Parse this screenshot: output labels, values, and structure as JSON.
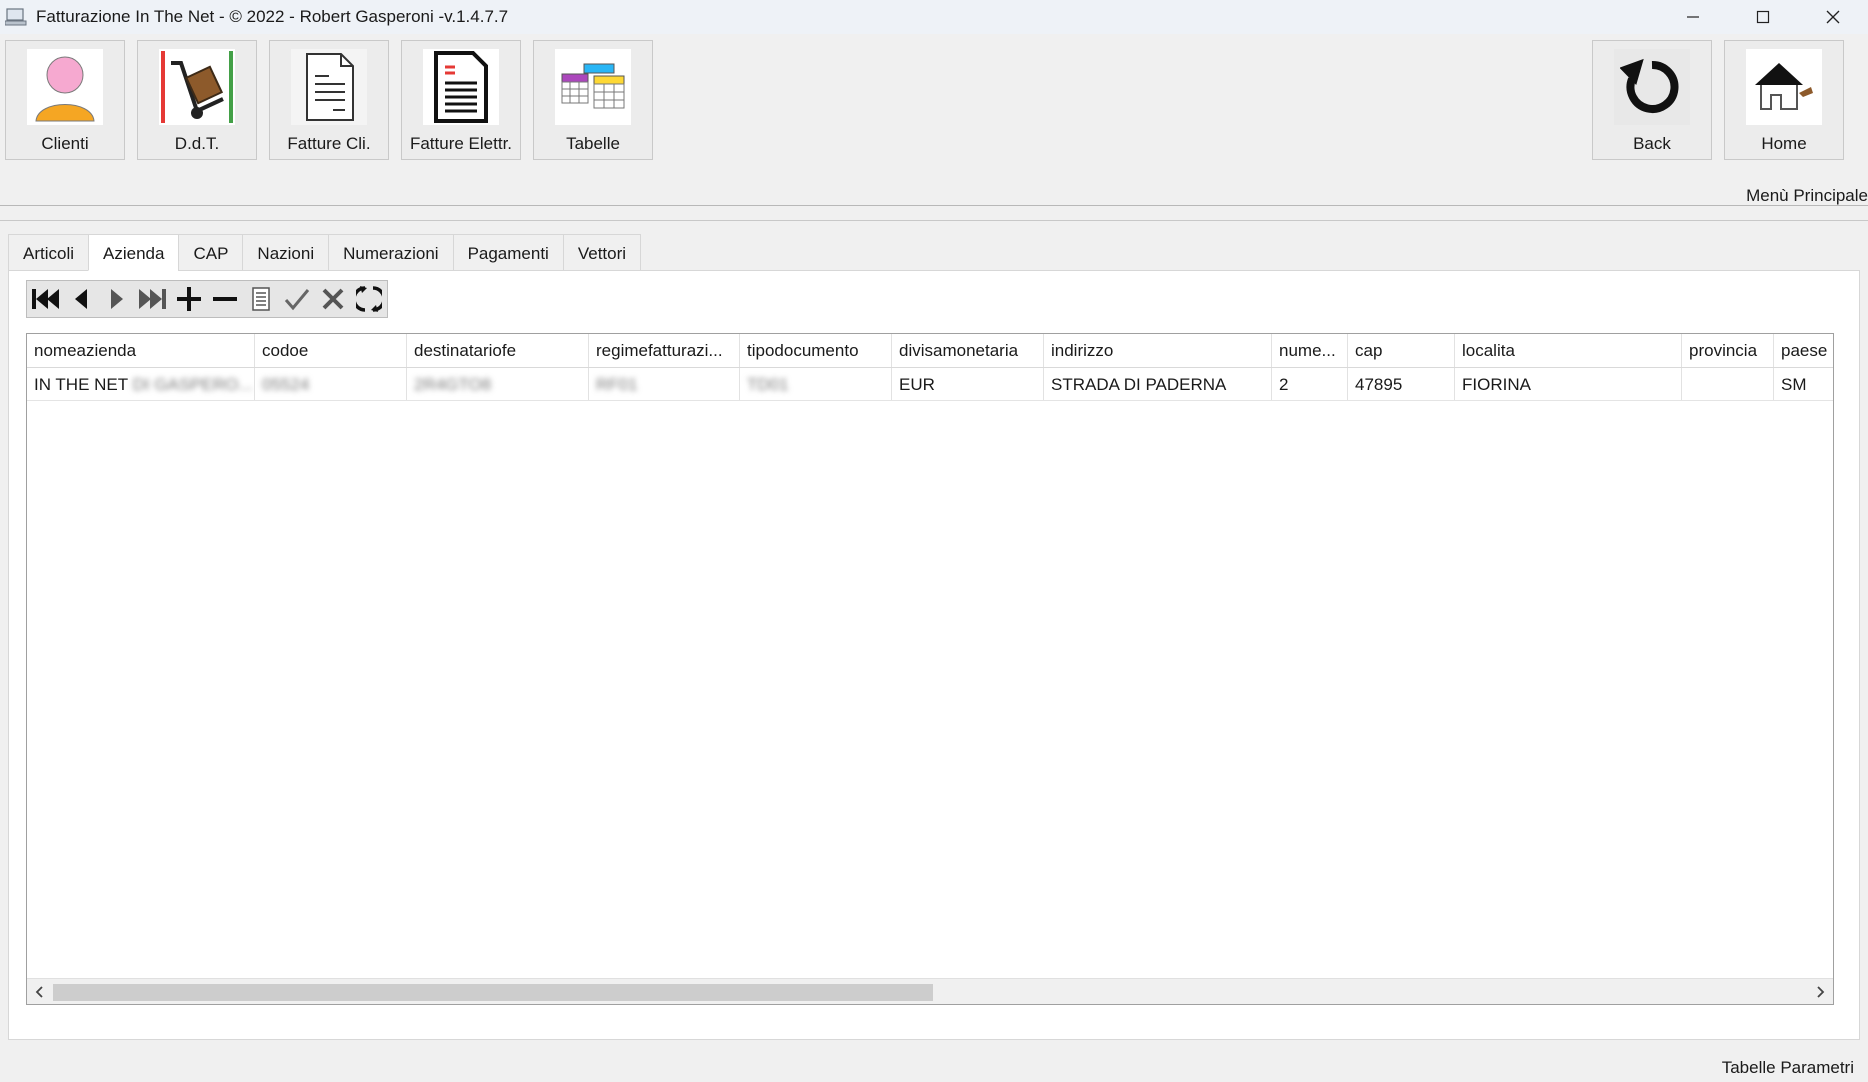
{
  "window": {
    "title": "Fatturazione In The Net - © 2022 - Robert Gasperoni -v.1.4.7.7"
  },
  "toolbar": {
    "left_buttons": [
      {
        "label": "Clienti",
        "icon": "person-icon"
      },
      {
        "label": "D.d.T.",
        "icon": "hand-truck-icon"
      },
      {
        "label": "Fatture Cli.",
        "icon": "document-icon"
      },
      {
        "label": "Fatture Elettr.",
        "icon": "electronic-invoice-icon"
      },
      {
        "label": "Tabelle",
        "icon": "tables-icon"
      }
    ],
    "right_buttons": [
      {
        "label": "Back",
        "icon": "refresh-back-icon"
      },
      {
        "label": "Home",
        "icon": "home-icon"
      }
    ],
    "section_label": "Menù Principale"
  },
  "tabs": [
    {
      "label": "Articoli",
      "active": false
    },
    {
      "label": "Azienda",
      "active": true
    },
    {
      "label": "CAP",
      "active": false
    },
    {
      "label": "Nazioni",
      "active": false
    },
    {
      "label": "Numerazioni",
      "active": false
    },
    {
      "label": "Pagamenti",
      "active": false
    },
    {
      "label": "Vettori",
      "active": false
    }
  ],
  "navigator": [
    "first-record-icon",
    "prior-record-icon",
    "next-record-icon",
    "last-record-icon",
    "insert-icon",
    "delete-icon",
    "edit-icon",
    "post-icon",
    "cancel-icon",
    "refresh-icon"
  ],
  "grid": {
    "columns": [
      "nomeazienda",
      "codoe",
      "destinatariofe",
      "regimefatturazi...",
      "tipodocumento",
      "divisamonetaria",
      "indirizzo",
      "nume...",
      "cap",
      "localita",
      "provincia",
      "paese"
    ],
    "rows": [
      {
        "nomeazienda": "IN THE NET",
        "nomeazienda_blurred": "DI GASPERO...",
        "codoe": "05524",
        "destinatariofe": "2R4GTO8",
        "regimefatturazione": "RF01",
        "tipodocumento": "TD01",
        "divisamonetaria": "EUR",
        "indirizzo": "STRADA DI PADERNA",
        "numero": "2",
        "cap": "47895",
        "localita": "FIORINA",
        "provincia": "",
        "paese": "SM"
      }
    ]
  },
  "status": "Tabelle Parametri"
}
